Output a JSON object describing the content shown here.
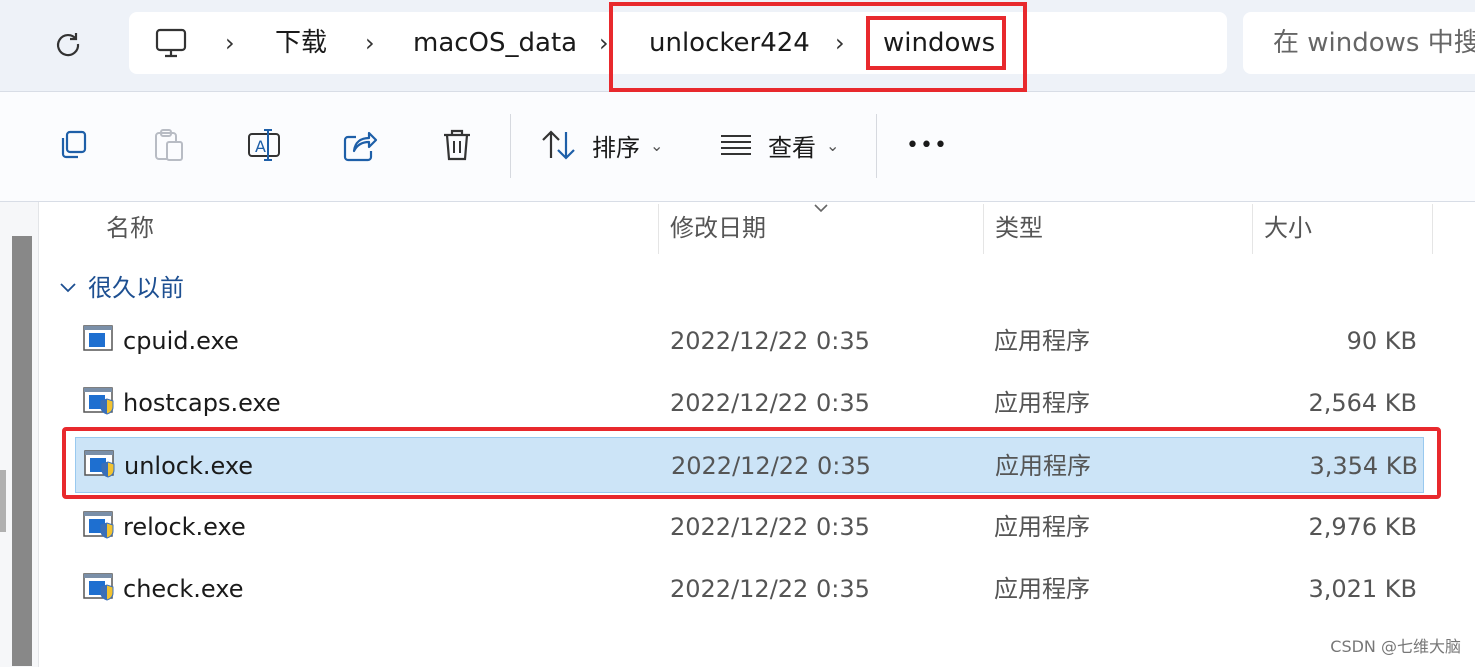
{
  "address": {
    "breadcrumbs": [
      "下载",
      "macOS_data",
      "unlocker424",
      "windows"
    ],
    "search_placeholder": "在 windows 中搜"
  },
  "toolbar": {
    "sort_label": "排序",
    "view_label": "查看",
    "more_label": "•••"
  },
  "columns": {
    "name": "名称",
    "modified": "修改日期",
    "type": "类型",
    "size": "大小"
  },
  "group": {
    "label": "很久以前"
  },
  "files": [
    {
      "name": "cpuid.exe",
      "modified": "2022/12/22 0:35",
      "type": "应用程序",
      "size": "90 KB"
    },
    {
      "name": "hostcaps.exe",
      "modified": "2022/12/22 0:35",
      "type": "应用程序",
      "size": "2,564 KB"
    },
    {
      "name": "unlock.exe",
      "modified": "2022/12/22 0:35",
      "type": "应用程序",
      "size": "3,354 KB"
    },
    {
      "name": "relock.exe",
      "modified": "2022/12/22 0:35",
      "type": "应用程序",
      "size": "2,976 KB"
    },
    {
      "name": "check.exe",
      "modified": "2022/12/22 0:35",
      "type": "应用程序",
      "size": "3,021 KB"
    }
  ],
  "selected_file": "unlock.exe",
  "watermark": "CSDN @七维大脑",
  "colors": {
    "highlight": "#e8292d",
    "selection": "#cce4f7",
    "group_text": "#1d4f91"
  }
}
